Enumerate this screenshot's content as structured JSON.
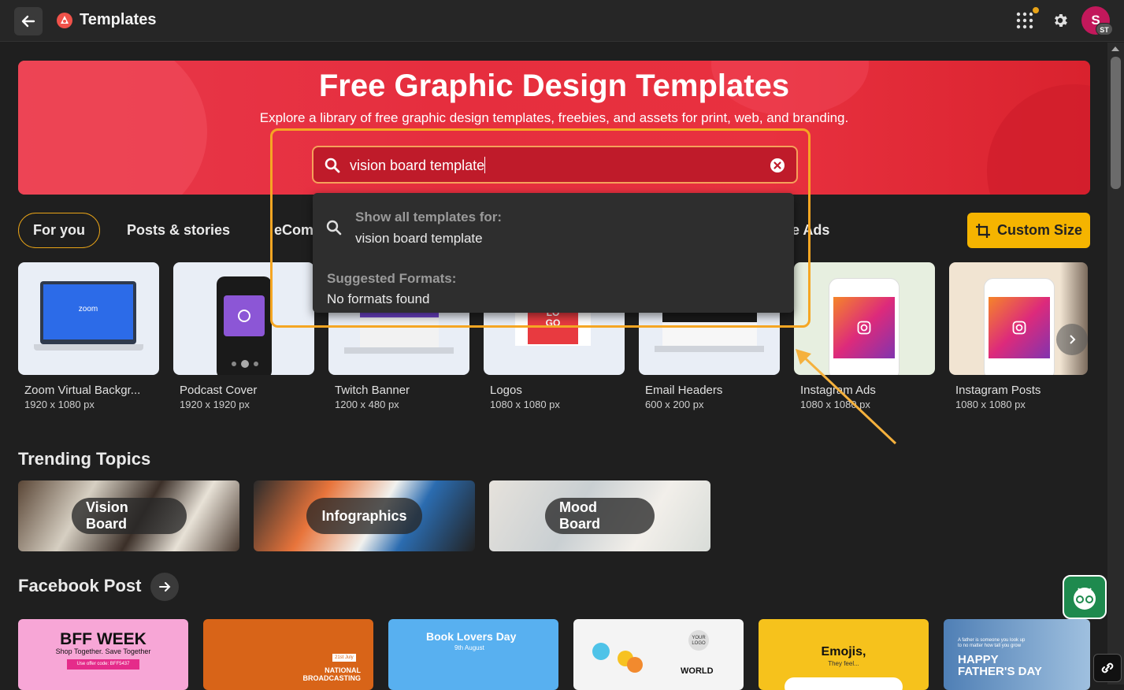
{
  "topbar": {
    "title": "Templates",
    "avatar_initial": "S",
    "avatar_badge": "ST"
  },
  "hero": {
    "title": "Free Graphic Design Templates",
    "subtitle": "Explore a library of free graphic design templates, freebies, and assets for print, web, and branding."
  },
  "search": {
    "value": "vision board template"
  },
  "dropdown": {
    "show_all_label": "Show all templates for:",
    "query": "vision board template",
    "suggested_label": "Suggested Formats:",
    "suggested_value": "No formats found"
  },
  "tabs": [
    {
      "label": "For you"
    },
    {
      "label": "Posts & stories"
    },
    {
      "label": "eCom"
    },
    {
      "label": "e Ads"
    }
  ],
  "custom_size_label": "Custom Size",
  "formats": [
    {
      "name": "Zoom Virtual Backgr...",
      "size": "1920 x 1080 px",
      "screen_text": "zoom"
    },
    {
      "name": "Podcast Cover",
      "size": "1920 x 1920 px"
    },
    {
      "name": "Twitch Banner",
      "size": "1200 x 480 px"
    },
    {
      "name": "Logos",
      "size": "1080 x 1080 px",
      "screen_text": "LO\nGO"
    },
    {
      "name": "Email Headers",
      "size": "600 x 200 px"
    },
    {
      "name": "Instagram Ads",
      "size": "1080 x 1080 px"
    },
    {
      "name": "Instagram Posts",
      "size": "1080 x 1080 px"
    }
  ],
  "trending": {
    "title": "Trending Topics",
    "topics": [
      {
        "label": "Vision Board"
      },
      {
        "label": "Infographics"
      },
      {
        "label": "Mood Board"
      }
    ]
  },
  "facebook": {
    "title": "Facebook Post",
    "cards": [
      {
        "headline": "BFF WEEK",
        "line": "Shop Together. Save Together",
        "code": "Use offer code: BFF5437"
      },
      {
        "tag": "21st July",
        "line": "NATIONAL BROADCASTING"
      },
      {
        "headline": "Book Lovers Day",
        "line": "9th August"
      },
      {
        "logo": "YOUR LOGO",
        "line": "WORLD"
      },
      {
        "headline": "Emojis,",
        "line": "They feel..."
      },
      {
        "line": "A father is someone you look up to no matter how tall you grow",
        "headline": "HAPPY FATHER'S DAY"
      }
    ]
  },
  "colors": {
    "accent": "#f5a623",
    "hero": "#e8384a",
    "custom_size": "#f5b400",
    "bot": "#1e8a4e"
  },
  "icons": [
    "back-arrow-icon",
    "app-logo-icon",
    "apps-grid-icon",
    "gear-icon",
    "search-icon",
    "clear-icon",
    "crop-icon",
    "chevron-right-icon",
    "arrow-right-icon",
    "bot-icon",
    "link-icon"
  ]
}
